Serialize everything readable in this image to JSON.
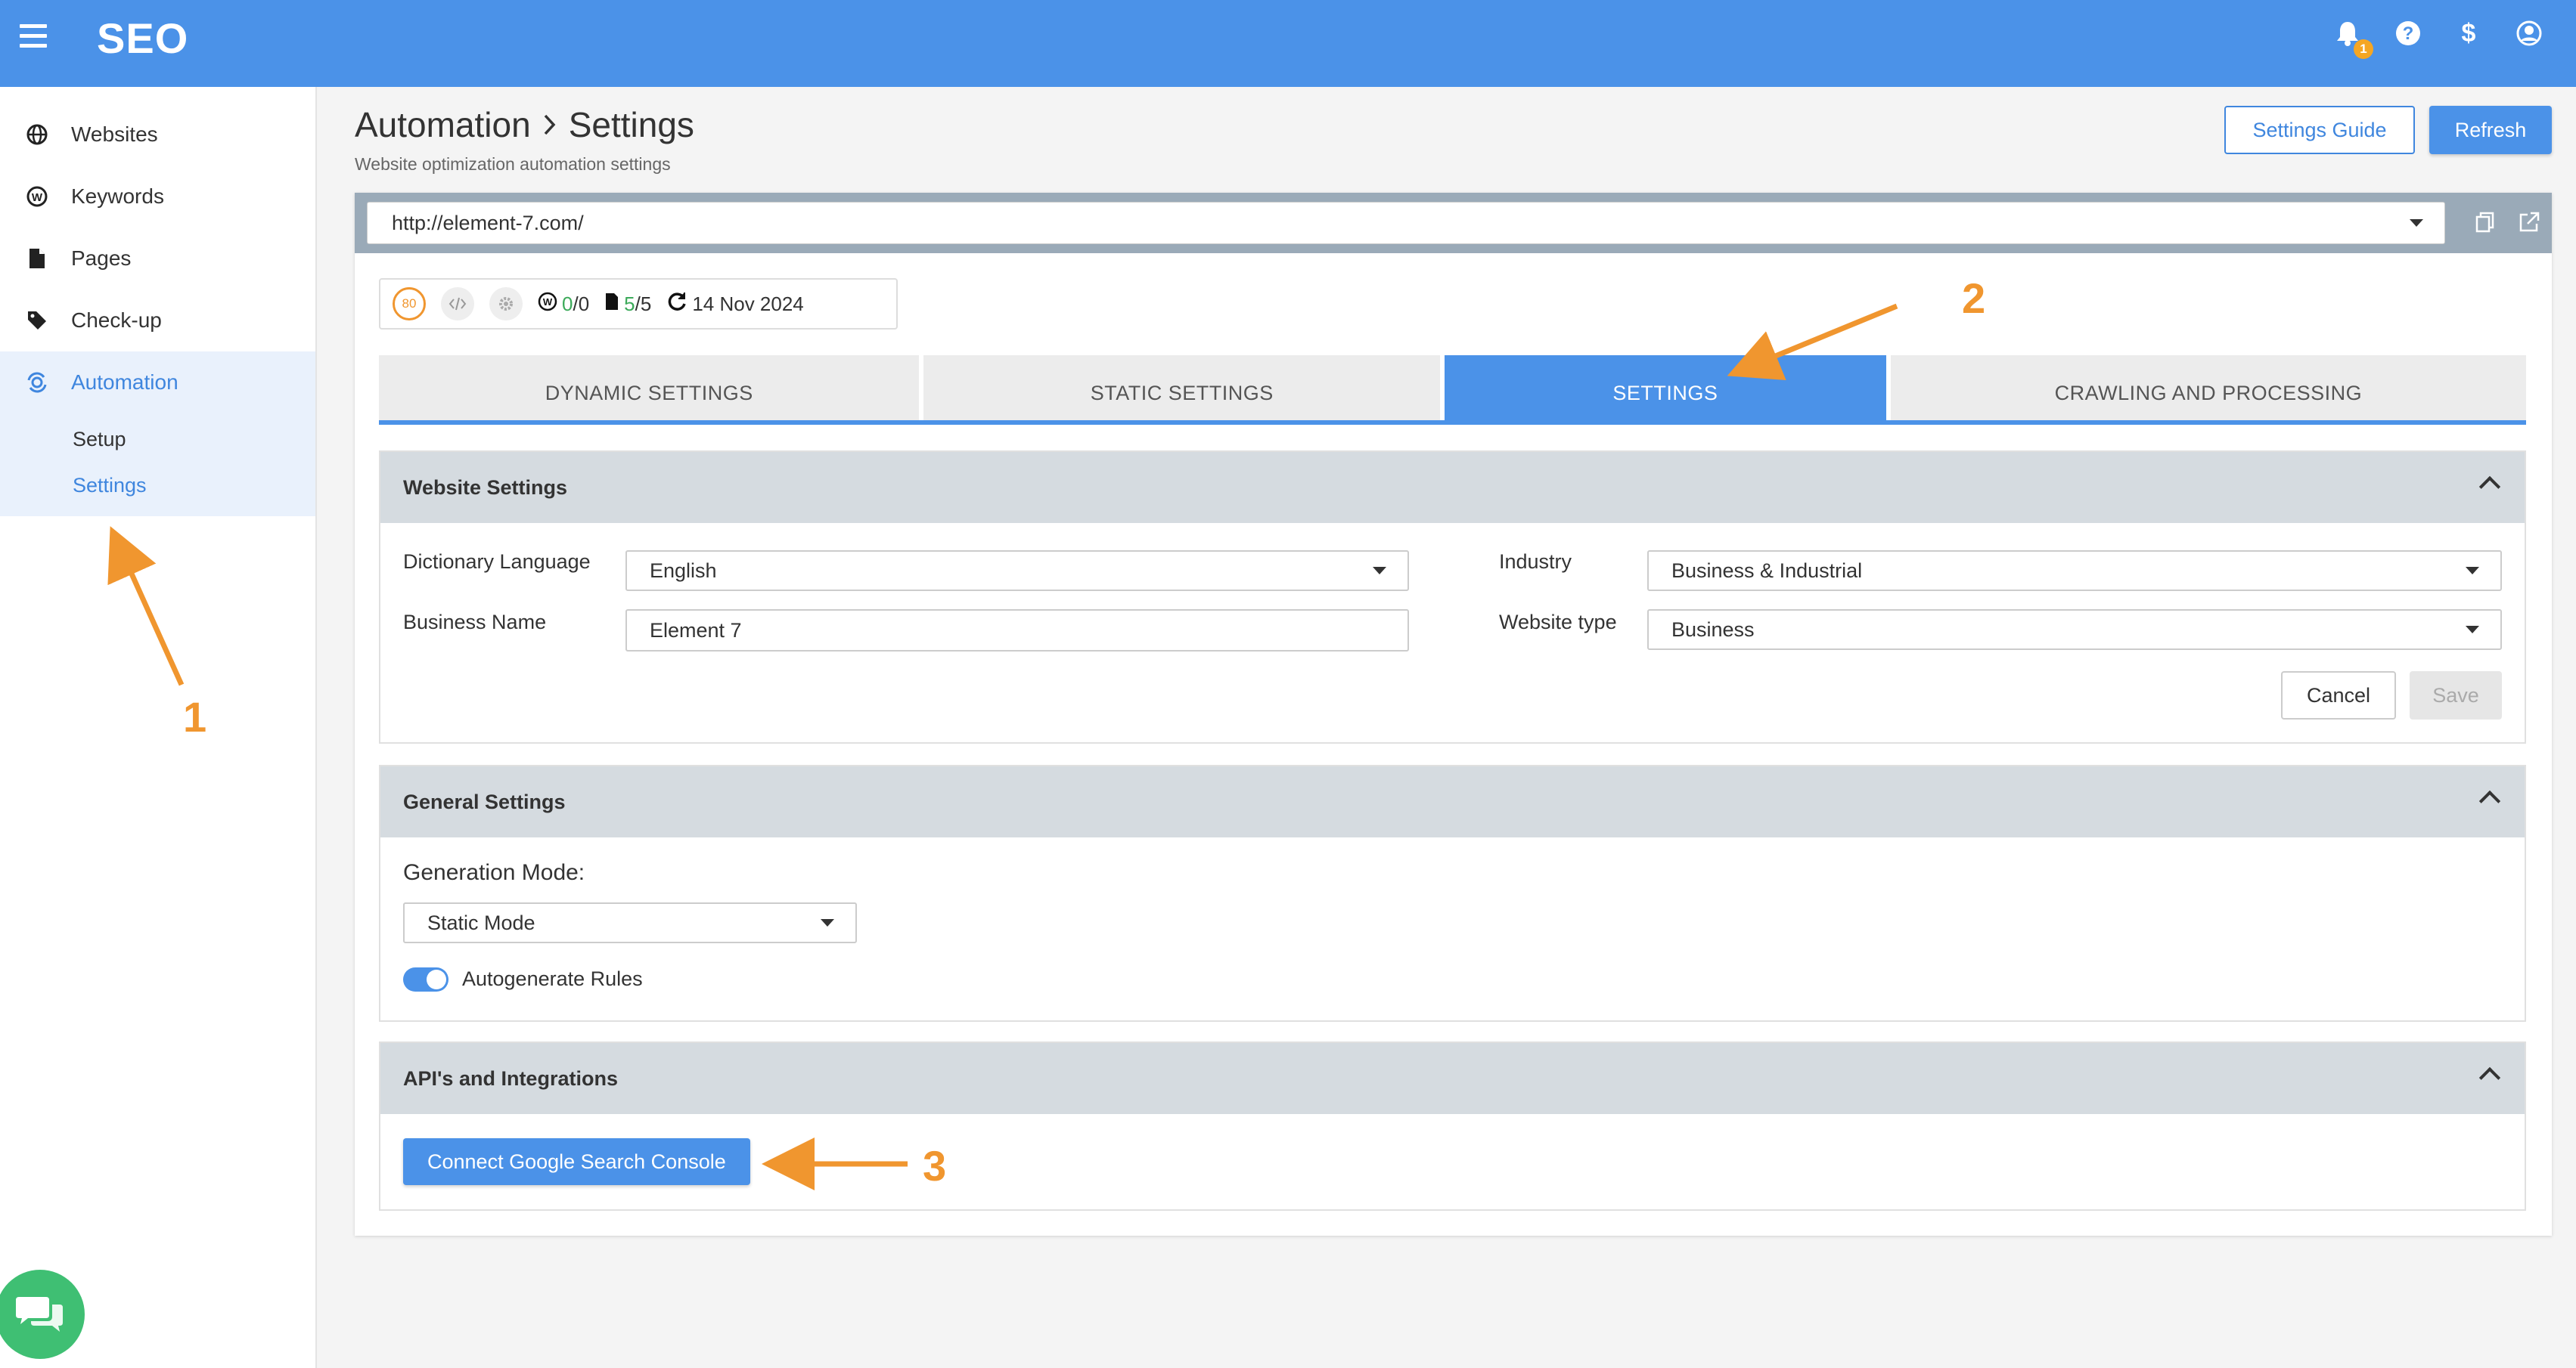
{
  "app": {
    "brand": "SEO",
    "notifications_count": "1"
  },
  "colors": {
    "primary": "#4b92e8",
    "annotation": "#f0962f",
    "header_bg": "#d5dbe0"
  },
  "sidebar": {
    "items": [
      {
        "label": "Websites",
        "icon": "globe-icon"
      },
      {
        "label": "Keywords",
        "icon": "keyword-w-icon"
      },
      {
        "label": "Pages",
        "icon": "file-icon"
      },
      {
        "label": "Check-up",
        "icon": "tag-icon"
      },
      {
        "label": "Automation",
        "icon": "automation-icon",
        "active": true
      }
    ],
    "sub_items": [
      {
        "label": "Setup"
      },
      {
        "label": "Settings",
        "active": true
      }
    ]
  },
  "header": {
    "breadcrumb_parent": "Automation",
    "breadcrumb_current": "Settings",
    "subtitle": "Website optimization automation settings",
    "settings_guide_label": "Settings Guide",
    "refresh_label": "Refresh"
  },
  "website": {
    "url": "http://element-7.com/"
  },
  "stats": {
    "score": "80",
    "keywords_used": "0",
    "keywords_total": "/0",
    "pages_used": "5",
    "pages_total": "/5",
    "date": "14 Nov 2024"
  },
  "tabs": [
    {
      "label": "DYNAMIC SETTINGS"
    },
    {
      "label": "STATIC SETTINGS"
    },
    {
      "label": "SETTINGS",
      "active": true
    },
    {
      "label": "CRAWLING AND PROCESSING"
    }
  ],
  "website_settings": {
    "title": "Website Settings",
    "dictionary_language_label": "Dictionary Language",
    "dictionary_language_value": "English",
    "business_name_label": "Business Name",
    "business_name_value": "Element 7",
    "industry_label": "Industry",
    "industry_value": "Business & Industrial",
    "website_type_label": "Website type",
    "website_type_value": "Business",
    "cancel_label": "Cancel",
    "save_label": "Save"
  },
  "general_settings": {
    "title": "General Settings",
    "generation_mode_label": "Generation Mode:",
    "generation_mode_value": "Static Mode",
    "autogenerate_label": "Autogenerate Rules",
    "autogenerate_on": true
  },
  "integrations": {
    "title": "API's and Integrations",
    "gsc_button_label": "Connect Google Search Console"
  },
  "annotations": [
    "1",
    "2",
    "3"
  ]
}
